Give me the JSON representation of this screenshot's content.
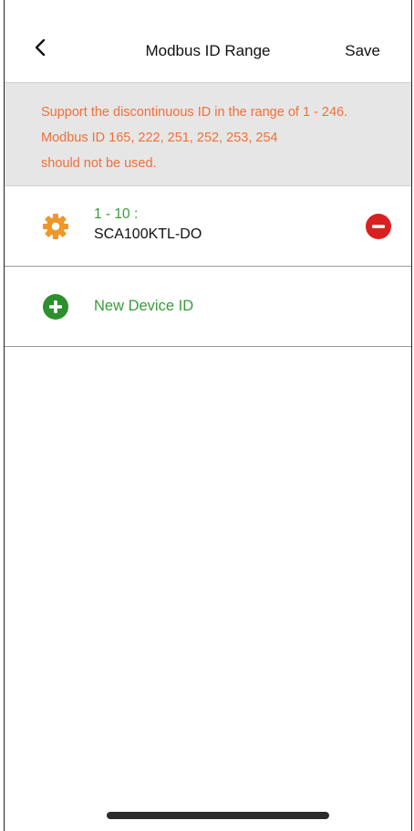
{
  "header": {
    "title": "Modbus ID Range",
    "save_label": "Save",
    "back_icon": "chevron-left-icon"
  },
  "notice": {
    "lines": [
      "Support the discontinuous ID in the range of 1 - 246.",
      "Modbus ID 165, 222, 251, 252, 253, 254",
      "should not be used."
    ],
    "color": "#f0703a"
  },
  "devices": [
    {
      "range": "1 - 10 :",
      "name": "SCA100KTL-DO",
      "icon": "gear-icon",
      "remove_icon": "remove-icon"
    }
  ],
  "new_device": {
    "label": "New Device ID",
    "icon": "add-icon"
  },
  "colors": {
    "accent_green": "#3a9a3a",
    "gear_orange": "#f0962a",
    "remove_red": "#d92020",
    "notice_bg": "#e6e6e6"
  }
}
